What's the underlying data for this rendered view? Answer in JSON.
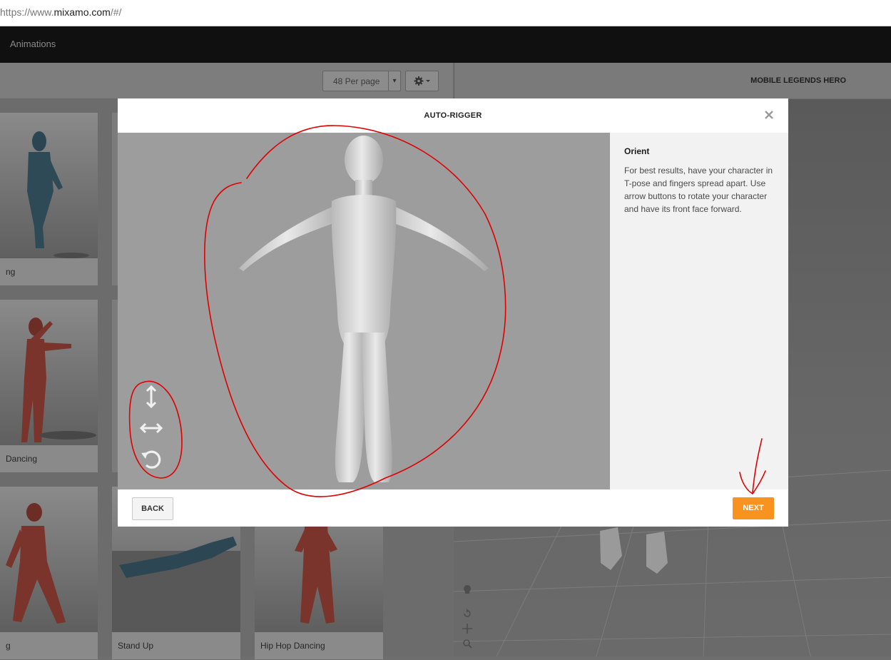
{
  "browser": {
    "url_prefix": "https://www.",
    "url_host": "mixamo.com",
    "url_path": "/#/"
  },
  "header": {
    "nav_animations": "Animations"
  },
  "toolbar": {
    "per_page": "48 Per page",
    "per_page_caret": "▾"
  },
  "right_panel": {
    "character_name": "MOBILE LEGENDS HERO"
  },
  "cards": [
    {
      "label": "ng"
    },
    {
      "label": ""
    },
    {
      "label": " Dancing"
    },
    {
      "label": ""
    },
    {
      "label": "g"
    },
    {
      "label": "Stand Up"
    },
    {
      "label": "Hip Hop Dancing"
    }
  ],
  "modal": {
    "title": "AUTO-RIGGER",
    "side_heading": "Orient",
    "side_text": "For best results, have your character in T-pose and fingers spread apart. Use arrow buttons to rotate your character and have its front face forward.",
    "back_label": "BACK",
    "next_label": "NEXT"
  },
  "icons": {
    "close": "close-icon",
    "vertical_rotate": "arrow-vertical-icon",
    "horizontal_rotate": "arrow-horizontal-icon",
    "rotate": "rotate-icon",
    "gear": "gear-icon"
  },
  "colors": {
    "next_button": "#f7931e",
    "annotation": "#e00000"
  }
}
